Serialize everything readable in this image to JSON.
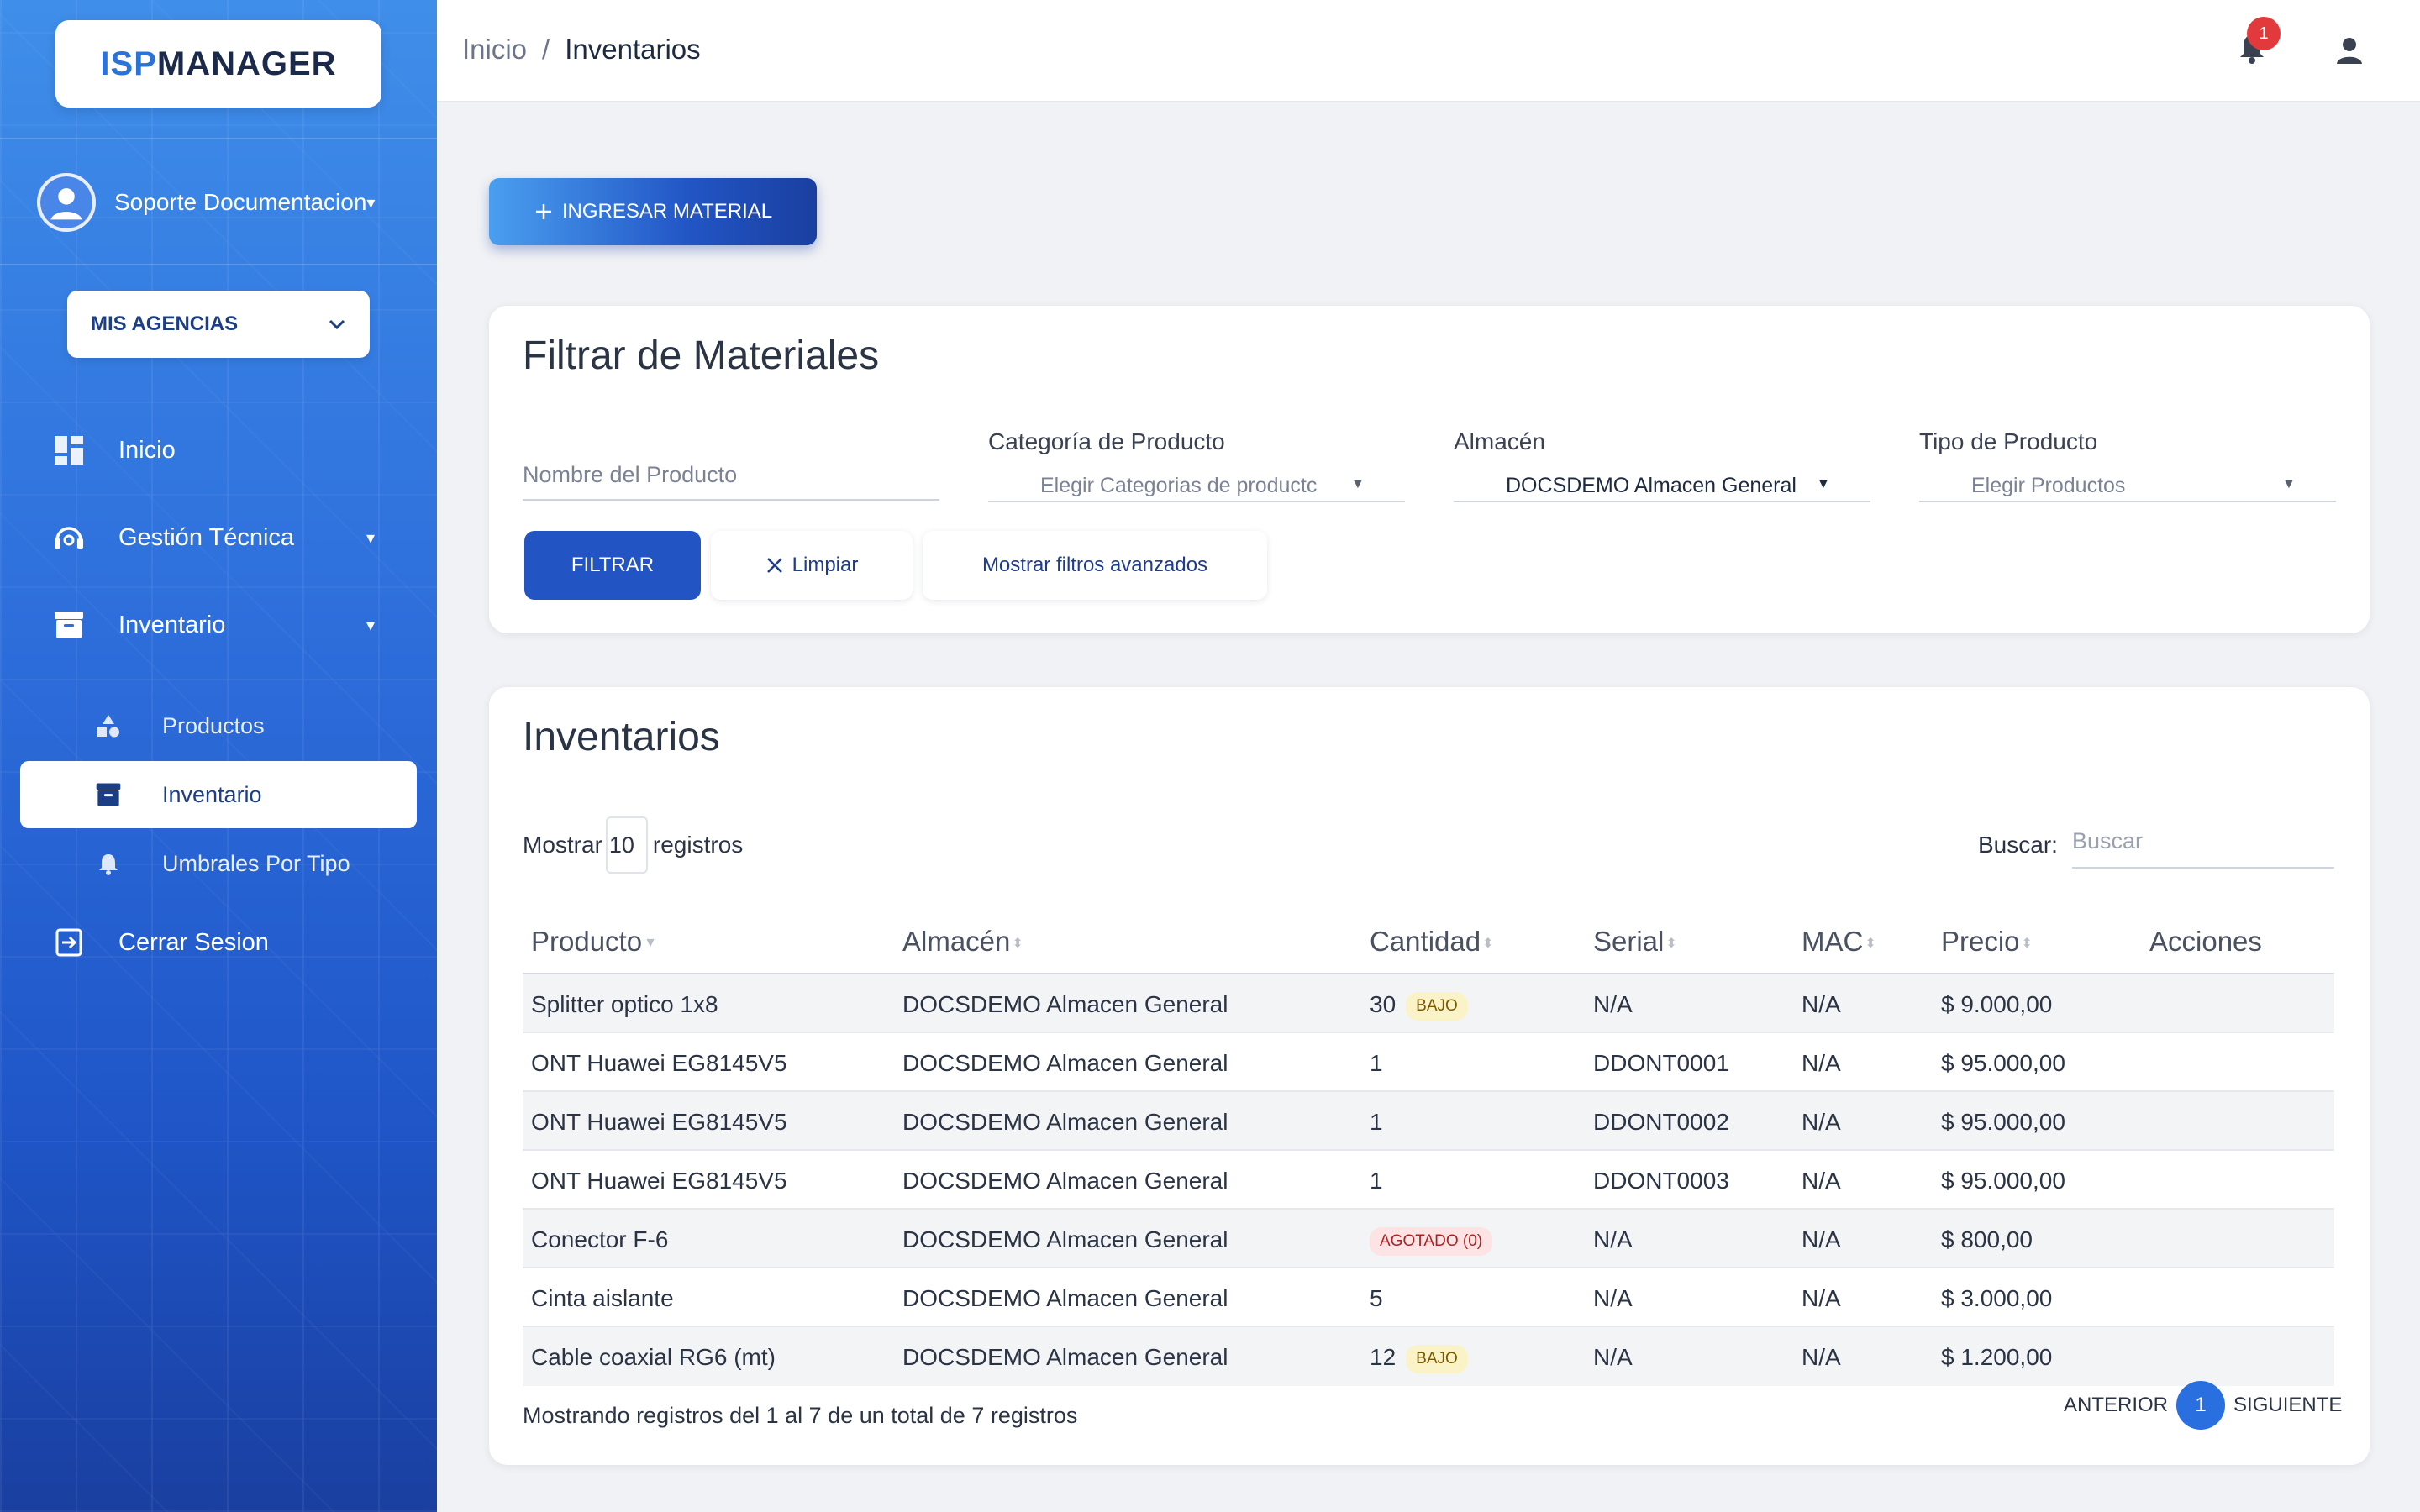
{
  "brand": {
    "logo_part1": "ISP",
    "logo_part2": "MANAGER",
    "accent": "#2a74d8"
  },
  "user": {
    "name": "Soporte Documentacion"
  },
  "agency": {
    "label": "MIS AGENCIAS"
  },
  "sidebar": {
    "items": [
      {
        "label": "Inicio"
      },
      {
        "label": "Gestión Técnica"
      },
      {
        "label": "Inventario"
      },
      {
        "label": "Productos"
      },
      {
        "label": "Inventario"
      },
      {
        "label": "Umbrales Por Tipo"
      },
      {
        "label": "Cerrar Sesion"
      }
    ]
  },
  "topbar": {
    "breadcrumb_home": "Inicio",
    "breadcrumb_sep": "/",
    "breadcrumb_current": "Inventarios",
    "notification_count": "1"
  },
  "actions": {
    "add_material": "INGRESAR MATERIAL"
  },
  "filter": {
    "title": "Filtrar de Materiales",
    "product_name_placeholder": "Nombre del Producto",
    "category_label": "Categoría de Producto",
    "category_value": "Elegir Categorias de productc",
    "warehouse_label": "Almacén",
    "warehouse_value": "DOCSDEMO Almacen General",
    "type_label": "Tipo de Producto",
    "type_value": "Elegir Productos",
    "btn_filter": "FILTRAR",
    "btn_clear": "Limpiar",
    "btn_advanced": "Mostrar filtros avanzados"
  },
  "inventory": {
    "title": "Inventarios",
    "show_prefix": "Mostrar",
    "show_value": "10",
    "show_suffix": "registros",
    "search_label": "Buscar:",
    "search_placeholder": "Buscar",
    "columns": [
      "Producto",
      "Almacén",
      "Cantidad",
      "Serial",
      "MAC",
      "Precio",
      "Acciones"
    ],
    "rows": [
      {
        "product": "Splitter optico 1x8",
        "warehouse": "DOCSDEMO Almacen General",
        "qty": "30",
        "badge": "BAJO",
        "serial": "N/A",
        "mac": "N/A",
        "price": "$ 9.000,00"
      },
      {
        "product": "ONT Huawei EG8145V5",
        "warehouse": "DOCSDEMO Almacen General",
        "qty": "1",
        "badge": "",
        "serial": "DDONT0001",
        "mac": "N/A",
        "price": "$ 95.000,00"
      },
      {
        "product": "ONT Huawei EG8145V5",
        "warehouse": "DOCSDEMO Almacen General",
        "qty": "1",
        "badge": "",
        "serial": "DDONT0002",
        "mac": "N/A",
        "price": "$ 95.000,00"
      },
      {
        "product": "ONT Huawei EG8145V5",
        "warehouse": "DOCSDEMO Almacen General",
        "qty": "1",
        "badge": "",
        "serial": "DDONT0003",
        "mac": "N/A",
        "price": "$ 95.000,00"
      },
      {
        "product": "Conector F-6",
        "warehouse": "DOCSDEMO Almacen General",
        "qty": "",
        "badge": "AGOTADO (0)",
        "serial": "N/A",
        "mac": "N/A",
        "price": "$ 800,00"
      },
      {
        "product": "Cinta aislante",
        "warehouse": "DOCSDEMO Almacen General",
        "qty": "5",
        "badge": "",
        "serial": "N/A",
        "mac": "N/A",
        "price": "$ 3.000,00"
      },
      {
        "product": "Cable coaxial RG6 (mt)",
        "warehouse": "DOCSDEMO Almacen General",
        "qty": "12",
        "badge": "BAJO",
        "serial": "N/A",
        "mac": "N/A",
        "price": "$ 1.200,00"
      }
    ],
    "footer_info": "Mostrando registros del 1 al 7 de un total de 7 registros",
    "pager_prev": "ANTERIOR",
    "pager_current": "1",
    "pager_next": "SIGUIENTE"
  }
}
